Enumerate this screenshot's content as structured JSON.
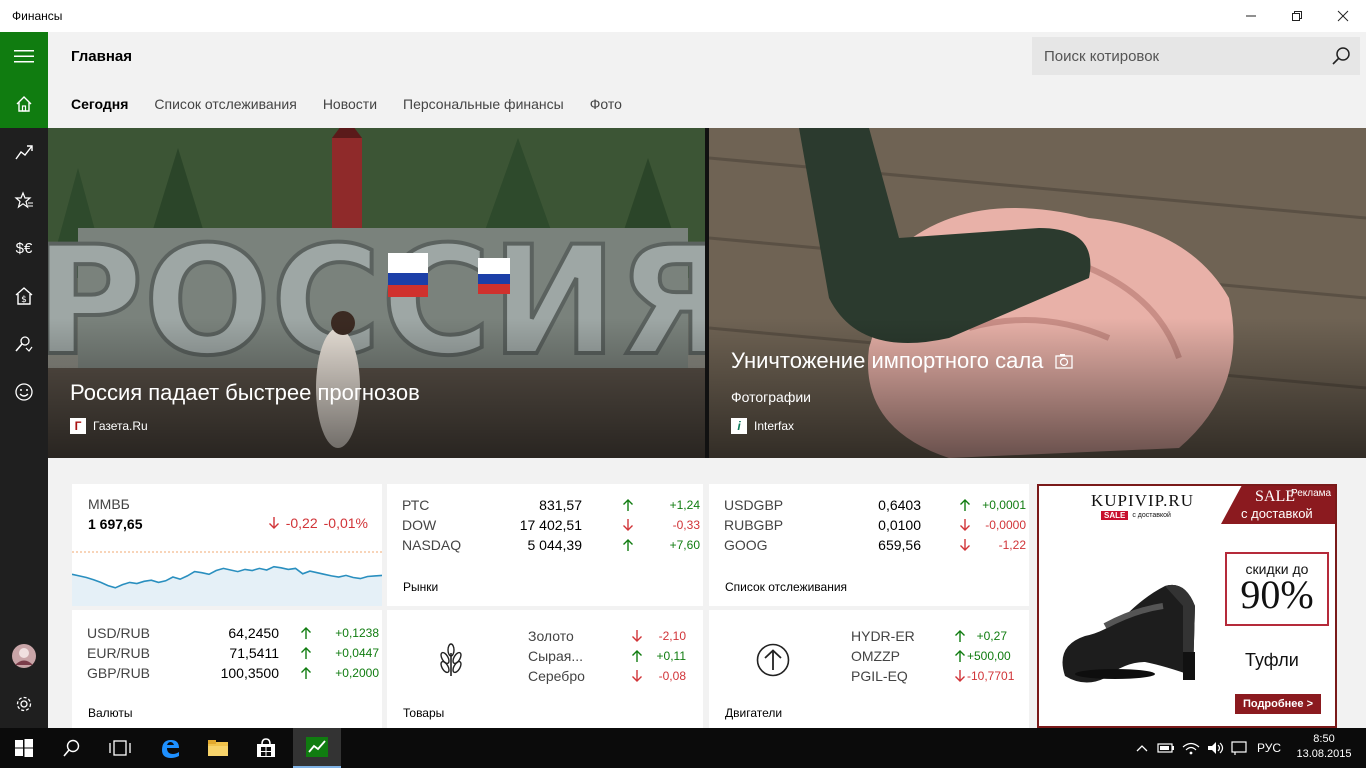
{
  "window": {
    "title": "Финансы"
  },
  "header": {
    "page_title": "Главная",
    "search_placeholder": "Поиск котировок"
  },
  "tabs": [
    {
      "label": "Сегодня",
      "active": true
    },
    {
      "label": "Список отслеживания"
    },
    {
      "label": "Новости"
    },
    {
      "label": "Персональные финансы"
    },
    {
      "label": "Фото"
    }
  ],
  "sidebar": {
    "icons": [
      "menu-icon",
      "home-icon",
      "markets-icon",
      "watchlist-icon",
      "currencies-icon",
      "mortgage-icon",
      "ratings-icon",
      "feedback-icon"
    ],
    "footer": [
      "user-avatar",
      "settings-icon"
    ]
  },
  "hero": {
    "left": {
      "title": "Россия падает быстрее прогнозов",
      "source": "Газета.Ru",
      "logo": "Г",
      "sign_text": "РОССИЯ"
    },
    "right": {
      "title": "Уничтожение импортного сала",
      "subtitle": "Фотографии",
      "source": "Interfax",
      "logo": "i"
    }
  },
  "mmvb": {
    "name": "ММВБ",
    "value": "1 697,65",
    "change": "-0,22",
    "percent": "-0,01%",
    "sparkline": [
      0.55,
      0.52,
      0.49,
      0.45,
      0.4,
      0.34,
      0.3,
      0.36,
      0.4,
      0.38,
      0.42,
      0.44,
      0.4,
      0.43,
      0.5,
      0.46,
      0.52,
      0.6,
      0.58,
      0.55,
      0.62,
      0.66,
      0.63,
      0.6,
      0.64,
      0.62,
      0.66,
      0.63,
      0.69,
      0.67,
      0.64,
      0.66,
      0.56,
      0.61,
      0.58,
      0.55,
      0.52,
      0.5,
      0.53,
      0.49,
      0.47,
      0.51,
      0.52,
      0.53
    ]
  },
  "markets": {
    "label": "Рынки",
    "rows": [
      {
        "name": "РТС",
        "value": "831,57",
        "change": "+1,24",
        "dir": "up"
      },
      {
        "name": "DOW",
        "value": "17 402,51",
        "change": "-0,33",
        "dir": "down"
      },
      {
        "name": "NASDAQ",
        "value": "5 044,39",
        "change": "+7,60",
        "dir": "up"
      }
    ]
  },
  "watchlist": {
    "label": "Список отслеживания",
    "rows": [
      {
        "name": "USDGBP",
        "value": "0,6403",
        "change": "+0,0001",
        "dir": "up"
      },
      {
        "name": "RUBGBP",
        "value": "0,0100",
        "change": "-0,0000",
        "dir": "down"
      },
      {
        "name": "GOOG",
        "value": "659,56",
        "change": "-1,22",
        "dir": "down"
      }
    ]
  },
  "currencies": {
    "label": "Валюты",
    "rows": [
      {
        "name": "USD/RUB",
        "value": "64,2450",
        "change": "+0,1238",
        "dir": "up"
      },
      {
        "name": "EUR/RUB",
        "value": "71,5411",
        "change": "+0,0447",
        "dir": "up"
      },
      {
        "name": "GBP/RUB",
        "value": "100,3500",
        "change": "+0,2000",
        "dir": "up"
      }
    ]
  },
  "commodities": {
    "label": "Товары",
    "rows": [
      {
        "name": "Золото",
        "change": "-2,10",
        "dir": "down"
      },
      {
        "name": "Сырая...",
        "change": "+0,11",
        "dir": "up"
      },
      {
        "name": "Серебро",
        "change": "-0,08",
        "dir": "down"
      }
    ]
  },
  "movers": {
    "label": "Двигатели",
    "rows": [
      {
        "name": "HYDR-ER",
        "change": "+0,27",
        "dir": "up"
      },
      {
        "name": "OMZZP",
        "change": "+500,00",
        "dir": "up"
      },
      {
        "name": "PGIL-EQ",
        "change": "-10,7701",
        "dir": "down"
      }
    ]
  },
  "ad": {
    "label": "Реклама",
    "brand": "KUPIVIP.RU",
    "brand_tag": "SALE",
    "brand_tag_sub": "с доставкой",
    "banner_top": "SALE",
    "banner_sub": "с доставкой",
    "discount_label": "скидки до",
    "discount_value": "90%",
    "product": "Туфли",
    "cta": "Подробнее >"
  },
  "taskbar": {
    "lang": "РУС",
    "time": "8:50",
    "date": "13.08.2015"
  },
  "colors": {
    "accent": "#107c10",
    "up": "#107c10",
    "down": "#d13438",
    "sidebar": "#1f1f1f",
    "header": "#f2f2f2",
    "ad_red": "#8b1a1f"
  }
}
